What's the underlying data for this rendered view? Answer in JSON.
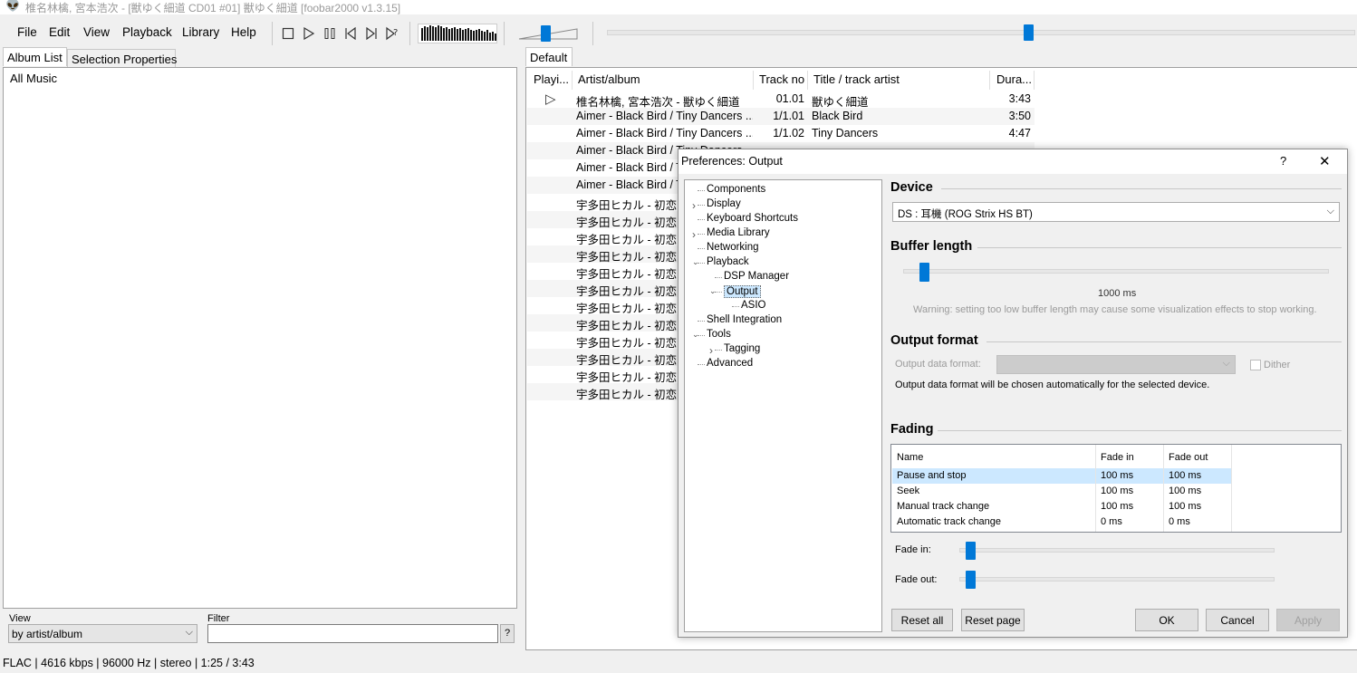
{
  "app": {
    "title": "椎名林檎, 宮本浩次 - [獣ゆく細道 CD01 #01] 獣ゆく細道   [foobar2000 v1.3.15]",
    "icon": "alien-icon"
  },
  "menu": [
    "File",
    "Edit",
    "View",
    "Playback",
    "Library",
    "Help"
  ],
  "toolbar": {
    "buttons": [
      "stop-icon",
      "play-icon",
      "pause-icon",
      "previous-icon",
      "next-icon",
      "random-icon"
    ],
    "volume_level": 0.45,
    "seek_position": 0.565
  },
  "left": {
    "tabs": [
      "Album List",
      "Selection Properties"
    ],
    "tree_root": "All Music",
    "view_label": "View",
    "view_value": "by artist/album",
    "filter_label": "Filter",
    "filter_value": "",
    "help_button": "?"
  },
  "playlist": {
    "tab": "Default",
    "columns": [
      "Playi...",
      "Artist/album",
      "Track no",
      "Title / track artist",
      "Dura..."
    ],
    "rows": [
      {
        "playing": "▷",
        "artist": "椎名林檎, 宮本浩次 - 獣ゆく細道",
        "track": "01.01",
        "title": "獣ゆく細道",
        "duration": "3:43"
      },
      {
        "playing": "",
        "artist": "Aimer - Black Bird / Tiny Dancers ...",
        "track": "1/1.01",
        "title": "Black Bird",
        "duration": "3:50"
      },
      {
        "playing": "",
        "artist": "Aimer - Black Bird / Tiny Dancers ...",
        "track": "1/1.02",
        "title": "Tiny Dancers",
        "duration": "4:47"
      },
      {
        "playing": "",
        "artist": "Aimer - Black Bird / Tiny Dancers ...",
        "track": "",
        "title": "",
        "duration": ""
      },
      {
        "playing": "",
        "artist": "Aimer - Black Bird / Tiny Dancers ...",
        "track": "",
        "title": "",
        "duration": ""
      },
      {
        "playing": "",
        "artist": "Aimer - Black Bird / Tiny Dancers ...",
        "track": "",
        "title": "",
        "duration": ""
      },
      {
        "playing": "",
        "artist": "宇多田ヒカル - 初恋",
        "track": "",
        "title": "",
        "duration": ""
      },
      {
        "playing": "",
        "artist": "宇多田ヒカル - 初恋",
        "track": "",
        "title": "",
        "duration": ""
      },
      {
        "playing": "",
        "artist": "宇多田ヒカル - 初恋",
        "track": "",
        "title": "",
        "duration": ""
      },
      {
        "playing": "",
        "artist": "宇多田ヒカル - 初恋",
        "track": "",
        "title": "",
        "duration": ""
      },
      {
        "playing": "",
        "artist": "宇多田ヒカル - 初恋",
        "track": "",
        "title": "",
        "duration": ""
      },
      {
        "playing": "",
        "artist": "宇多田ヒカル - 初恋",
        "track": "",
        "title": "",
        "duration": ""
      },
      {
        "playing": "",
        "artist": "宇多田ヒカル - 初恋",
        "track": "",
        "title": "",
        "duration": ""
      },
      {
        "playing": "",
        "artist": "宇多田ヒカル - 初恋",
        "track": "",
        "title": "",
        "duration": ""
      },
      {
        "playing": "",
        "artist": "宇多田ヒカル - 初恋",
        "track": "",
        "title": "",
        "duration": ""
      },
      {
        "playing": "",
        "artist": "宇多田ヒカル - 初恋",
        "track": "",
        "title": "",
        "duration": ""
      },
      {
        "playing": "",
        "artist": "宇多田ヒカル - 初恋",
        "track": "",
        "title": "",
        "duration": ""
      },
      {
        "playing": "",
        "artist": "宇多田ヒカル - 初恋",
        "track": "",
        "title": "",
        "duration": ""
      }
    ]
  },
  "status": "FLAC | 4616 kbps | 96000 Hz | stereo | 1:25 / 3:43",
  "prefs": {
    "title": "Preferences: Output",
    "help": "?",
    "close": "✕",
    "tree": [
      {
        "label": "Components",
        "level": 0,
        "exp": ""
      },
      {
        "label": "Display",
        "level": 0,
        "exp": ">"
      },
      {
        "label": "Keyboard Shortcuts",
        "level": 0,
        "exp": ""
      },
      {
        "label": "Media Library",
        "level": 0,
        "exp": ">"
      },
      {
        "label": "Networking",
        "level": 0,
        "exp": ""
      },
      {
        "label": "Playback",
        "level": 0,
        "exp": "v"
      },
      {
        "label": "DSP Manager",
        "level": 1,
        "exp": ""
      },
      {
        "label": "Output",
        "level": 1,
        "exp": "v"
      },
      {
        "label": "ASIO",
        "level": 2,
        "exp": ""
      },
      {
        "label": "Shell Integration",
        "level": 0,
        "exp": ""
      },
      {
        "label": "Tools",
        "level": 0,
        "exp": "v"
      },
      {
        "label": "Tagging",
        "level": 1,
        "exp": ">"
      },
      {
        "label": "Advanced",
        "level": 0,
        "exp": ""
      }
    ],
    "device_label": "Device",
    "device_value": "DS : 耳機 (ROG Strix HS BT)",
    "buffer_label": "Buffer length",
    "buffer_value": "1000 ms",
    "buffer_level": 0.04,
    "buffer_warning": "Warning: setting too low buffer length may cause some visualization effects to stop working.",
    "output_format_label": "Output format",
    "output_data_format_label": "Output data format:",
    "dither_label": "Dither",
    "output_format_note": "Output data format will be chosen automatically for the selected device.",
    "fading_label": "Fading",
    "fading_columns": [
      "Name",
      "Fade in",
      "Fade out"
    ],
    "fading_rows": [
      {
        "name": "Pause and stop",
        "in": "100 ms",
        "out": "100 ms"
      },
      {
        "name": "Seek",
        "in": "100 ms",
        "out": "100 ms"
      },
      {
        "name": "Manual track change",
        "in": "100 ms",
        "out": "100 ms"
      },
      {
        "name": "Automatic track change",
        "in": "0 ms",
        "out": "0 ms"
      }
    ],
    "fade_in_label": "Fade in:",
    "fade_out_label": "Fade out:",
    "fade_in_level": 0.02,
    "fade_out_level": 0.02,
    "buttons": {
      "reset_all": "Reset all",
      "reset_page": "Reset page",
      "ok": "OK",
      "cancel": "Cancel",
      "apply": "Apply"
    }
  }
}
